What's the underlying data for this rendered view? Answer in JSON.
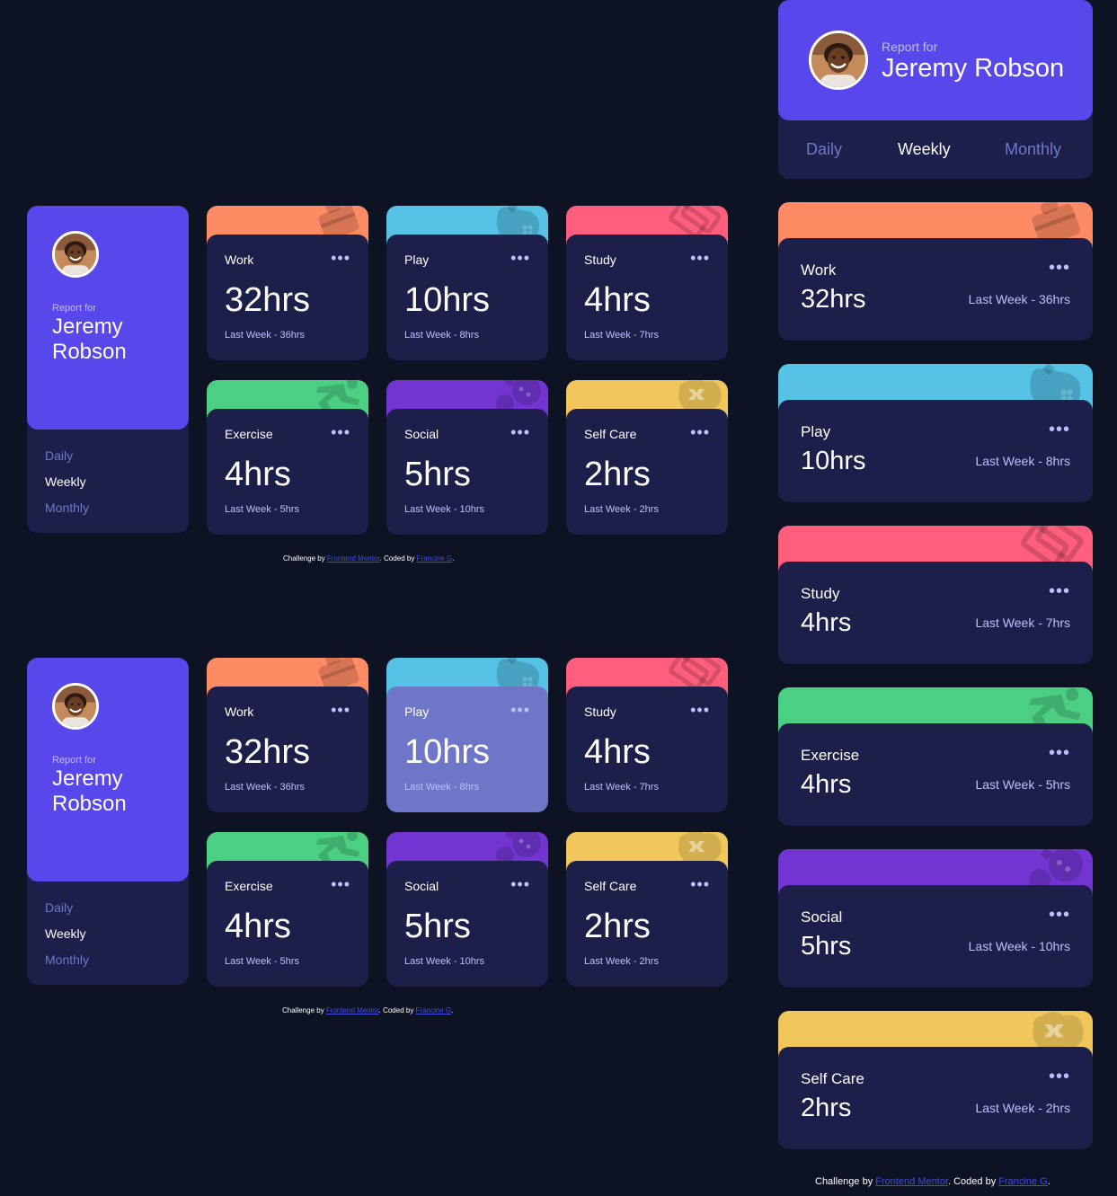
{
  "profile": {
    "report_for": "Report for",
    "name": "Jeremy Robson",
    "name_line1": "Jeremy",
    "name_line2": "Robson"
  },
  "periods": [
    "Daily",
    "Weekly",
    "Monthly"
  ],
  "active_period": "Weekly",
  "activities": [
    {
      "title": "Work",
      "hours": "32hrs",
      "previous": "Last Week - 36hrs",
      "color": "#ff8b64",
      "icon": "briefcase-icon"
    },
    {
      "title": "Play",
      "hours": "10hrs",
      "previous": "Last Week - 8hrs",
      "color": "#55c2e6",
      "icon": "gamepad-icon"
    },
    {
      "title": "Study",
      "hours": "4hrs",
      "previous": "Last Week - 7hrs",
      "color": "#ff5e7d",
      "icon": "book-icon"
    },
    {
      "title": "Exercise",
      "hours": "4hrs",
      "previous": "Last Week - 5hrs",
      "color": "#4bcf82",
      "icon": "running-icon"
    },
    {
      "title": "Social",
      "hours": "5hrs",
      "previous": "Last Week - 10hrs",
      "color": "#7335d2",
      "icon": "social-icon"
    },
    {
      "title": "Self Care",
      "hours": "2hrs",
      "previous": "Last Week - 2hrs",
      "color": "#f1c75b",
      "icon": "self-care-icon"
    }
  ],
  "menu_label": "•••",
  "footer": {
    "prefix": "Challenge by ",
    "link1": "Frontend Mentor",
    "middle": ". Coded by ",
    "link2": "Francine G",
    "suffix": "."
  },
  "colors": {
    "background": "#0e1323",
    "card": "#1c1f4a",
    "profile": "#5847eb",
    "muted": "#bbc0ff",
    "period_inactive": "#7078c9",
    "hover_card": "#6f76c8"
  }
}
